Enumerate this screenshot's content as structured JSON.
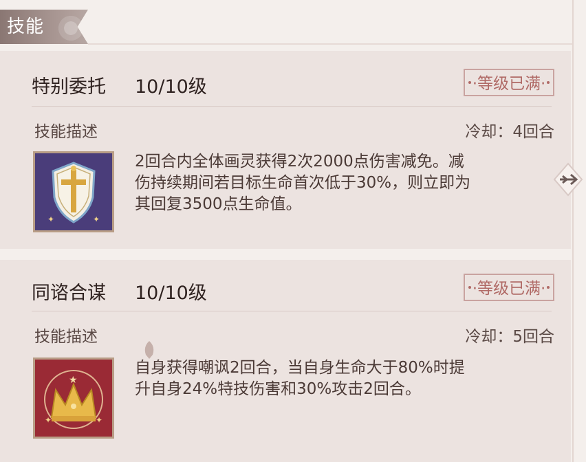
{
  "header": {
    "title": "技能"
  },
  "skills": [
    {
      "name": "特别委托",
      "level": "10/10级",
      "status": "·等级已满·",
      "desc_label": "技能描述",
      "cooldown": "冷却：4回合",
      "description_lines": [
        "2回合内全体画灵获得2次2000点伤害减免。减",
        "伤持续期间若目标生命首次低于30%，则立即为",
        "其回复3500点生命值。"
      ],
      "icon": "shield-cross-icon"
    },
    {
      "name": "同谘合谋",
      "level": "10/10级",
      "status": "·等级已满·",
      "desc_label": "技能描述",
      "cooldown": "冷却：5回合",
      "description_lines": [
        "自身获得嘲讽2回合，当自身生命大于80%时提",
        "升自身24%特技伤害和30%攻击2回合。"
      ],
      "icon": "crown-icon"
    }
  ],
  "colors": {
    "background": "#f4efec",
    "card": "#ece3e0",
    "badge": "#b06a66",
    "icon1_bg": "#4a3d7a",
    "icon2_bg": "#9a2a35"
  }
}
